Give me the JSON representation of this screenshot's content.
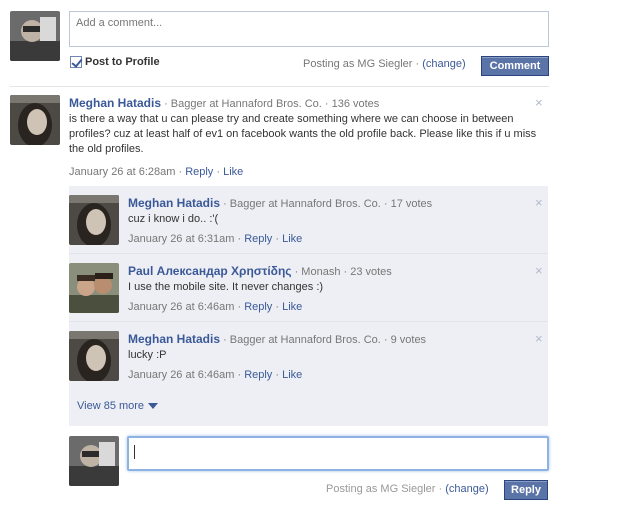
{
  "composer": {
    "placeholder": "Add a comment...",
    "post_to_profile_label": "Post to Profile",
    "posting_as_prefix": "Posting as MG Siegler · ",
    "change_link": "(change)",
    "comment_button": "Comment"
  },
  "comments": [
    {
      "author": "Meghan Hatadis",
      "meta": " · Bagger at Hannaford Bros. Co. · 136 votes",
      "text": "is there a way that u can please try and create something where we can choose in between profiles? cuz at least half of ev1 on facebook wants the old profile back. Please like this if u miss the old profiles.",
      "time": "January 26 at 6:28am",
      "reply_link": "Reply",
      "like_link": "Like",
      "sep": " · "
    }
  ],
  "replies": [
    {
      "author": "Meghan Hatadis",
      "meta": " · Bagger at Hannaford Bros. Co. · 17 votes",
      "text": "cuz i know i do.. :'(",
      "time": "January 26 at 6:31am",
      "reply_link": "Reply",
      "like_link": "Like",
      "sep": " · "
    },
    {
      "author": "Paul Александар Χρηστίδης",
      "meta": " · Monash · 23 votes",
      "text": "I use the mobile site. It never changes :)",
      "time": "January 26 at 6:46am",
      "reply_link": "Reply",
      "like_link": "Like",
      "sep": " · "
    },
    {
      "author": "Meghan Hatadis",
      "meta": " · Bagger at Hannaford Bros. Co. · 9 votes",
      "text": "lucky :P",
      "time": "January 26 at 6:46am",
      "reply_link": "Reply",
      "like_link": "Like",
      "sep": " · "
    }
  ],
  "view_more": "View 85 more",
  "reply_box": {
    "posting_as_prefix": "Posting as MG Siegler · ",
    "change_link": "(change)",
    "reply_button": "Reply"
  },
  "close_glyph": "×",
  "colors": {
    "link": "#3b5998",
    "button": "#5b74a8",
    "reply_bg": "#edeff4"
  }
}
